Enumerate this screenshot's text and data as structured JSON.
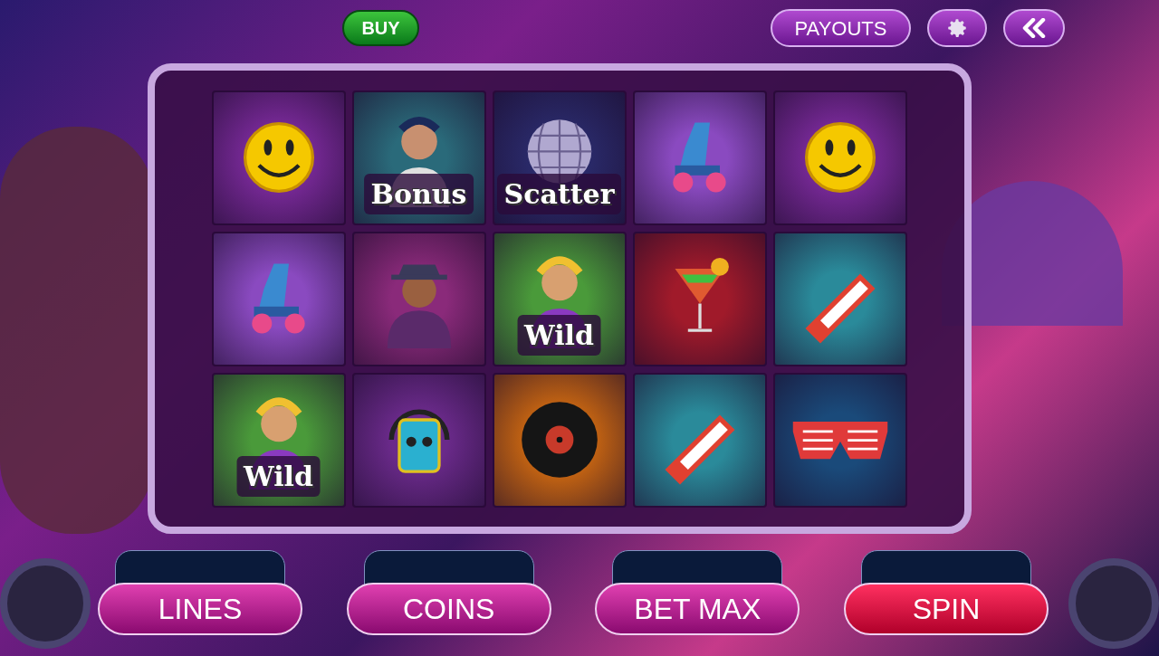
{
  "top_bar": {
    "buy_button": "BUY",
    "payouts_button": "PAYOUTS"
  },
  "reels": [
    [
      {
        "kind": "smiley"
      },
      {
        "kind": "roller-skate"
      },
      {
        "kind": "wild",
        "label": "Wild"
      }
    ],
    [
      {
        "kind": "bonus",
        "label": "Bonus"
      },
      {
        "kind": "man"
      },
      {
        "kind": "cassette"
      }
    ],
    [
      {
        "kind": "scatter",
        "label": "Scatter"
      },
      {
        "kind": "wild",
        "label": "Wild"
      },
      {
        "kind": "vinyl"
      }
    ],
    [
      {
        "kind": "roller-skate"
      },
      {
        "kind": "cocktail"
      },
      {
        "kind": "keytar"
      }
    ],
    [
      {
        "kind": "smiley"
      },
      {
        "kind": "keytar"
      },
      {
        "kind": "glasses"
      }
    ]
  ],
  "controls": [
    {
      "label": "LINES",
      "kind": "normal"
    },
    {
      "label": "COINS",
      "kind": "normal"
    },
    {
      "label": "BET MAX",
      "kind": "normal"
    },
    {
      "label": "SPIN",
      "kind": "spin"
    }
  ]
}
